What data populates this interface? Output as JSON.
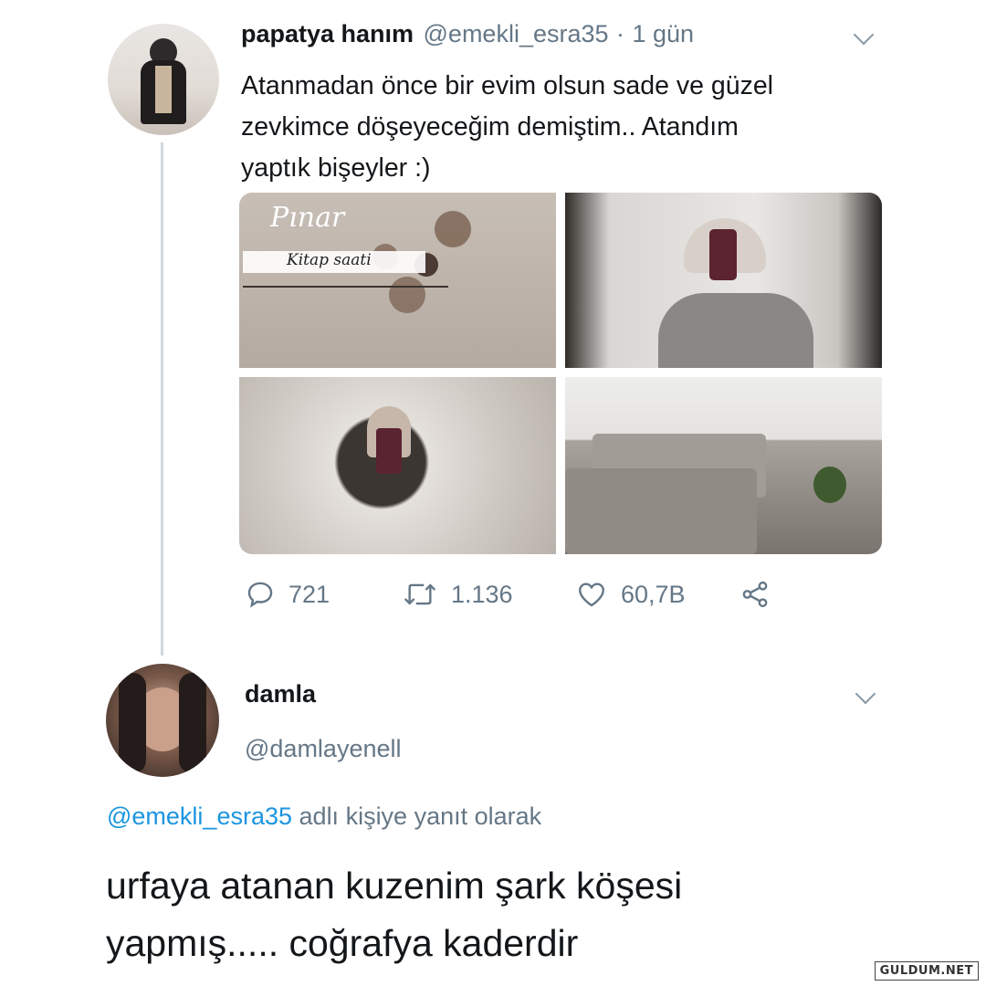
{
  "tweet": {
    "author_name": "papatya hanım",
    "author_handle": "@emekli_esra35",
    "separator": "·",
    "time": "1 gün",
    "text_lines": [
      "Atanmadan önce bir evim olsun sade ve güzel",
      "zevkimce döşeyeceğim demiştim.. Atandım",
      "yaptık bişeyler :)"
    ],
    "media_caption_1": "Pınar",
    "media_caption_2": "Kitap saati",
    "actions": {
      "reply_count": "721",
      "retweet_count": "1.136",
      "like_count": "60,7B"
    }
  },
  "reply": {
    "author_name": "damla",
    "author_handle": "@damlayenell",
    "reply_to_mention": "@emekli_esra35",
    "reply_to_suffix": "adlı kişiye yanıt olarak",
    "text_lines": [
      "urfaya atanan kuzenim şark köşesi",
      "yapmış..... coğrafya kaderdir"
    ]
  },
  "watermark": "GULDUM.NET",
  "icons": [
    "chevron-down-icon",
    "reply-icon",
    "retweet-icon",
    "like-icon",
    "share-icon"
  ],
  "colors": {
    "text": "#14171a",
    "muted": "#657786",
    "link": "#1b95e0",
    "thread_line": "#cfd9de"
  }
}
